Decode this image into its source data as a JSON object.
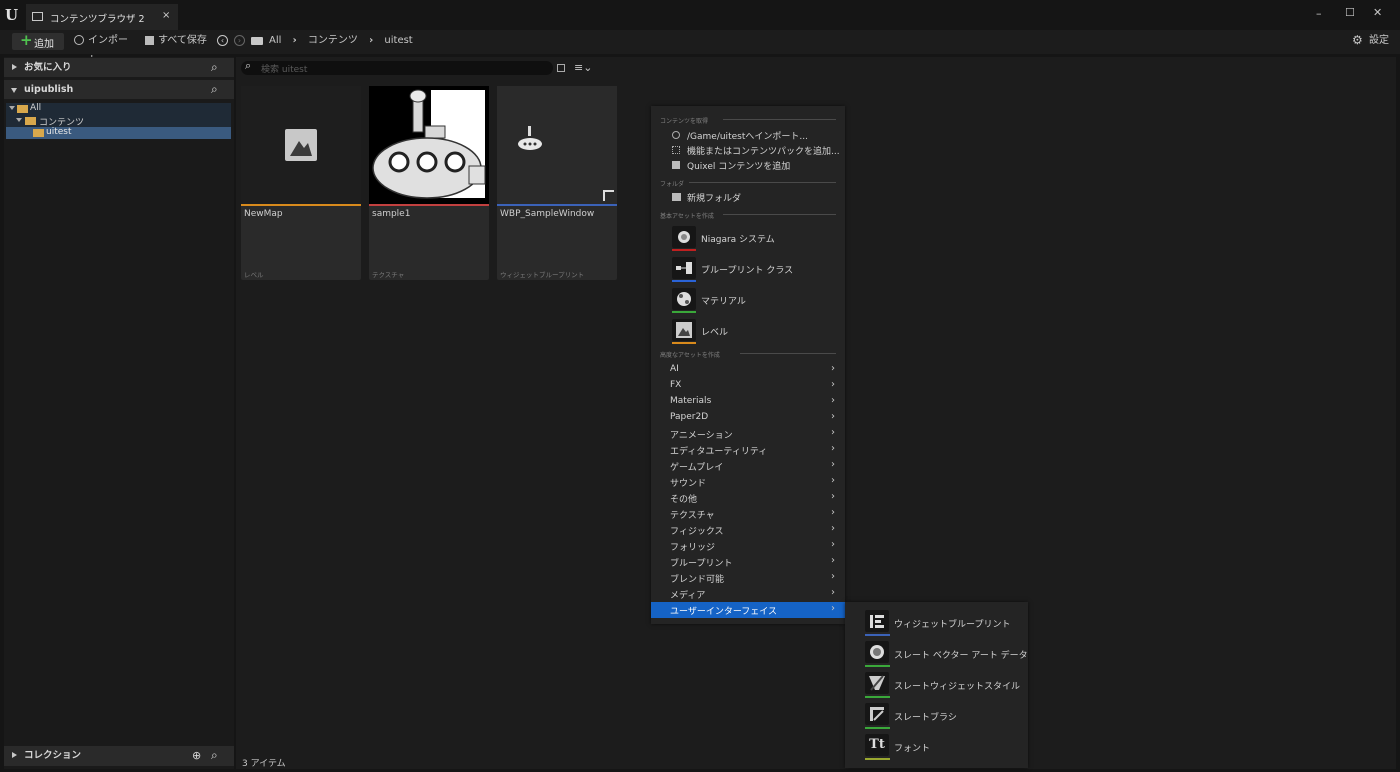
{
  "window": {
    "tab_title": "コンテンツブラウザ 2",
    "tab_close": "×",
    "controls": {
      "minimize": "–",
      "maximize": "☐",
      "close": "✕"
    }
  },
  "toolbar": {
    "add_label": "追加",
    "import_label": "インポート",
    "save_all_label": "すべて保存",
    "breadcrumb": [
      "All",
      "コンテンツ",
      "uitest"
    ],
    "settings_label": "設定"
  },
  "sidebar": {
    "favorites_label": "お気に入り",
    "project_label": "uipublish",
    "tree": [
      {
        "label": "All"
      },
      {
        "label": "コンテンツ"
      },
      {
        "label": "uitest"
      }
    ],
    "collections_label": "コレクション"
  },
  "content": {
    "search_placeholder": "検索 uitest",
    "item_count": "3 アイテム",
    "assets": [
      {
        "name": "NewMap",
        "type": "レベル",
        "color": "#d88a1c"
      },
      {
        "name": "sample1",
        "type": "テクスチャ",
        "color": "#c2403f"
      },
      {
        "name": "WBP_SampleWindow",
        "type": "ウィジェットブループリント",
        "color": "#3b62b8"
      }
    ]
  },
  "context_menu": {
    "section_get_content": "コンテンツを取得",
    "import_to": "/Game/uitestへインポート...",
    "add_feature_pack": "機能またはコンテンツパックを追加...",
    "add_quixel": "Quixel コンテンツを追加",
    "section_folder": "フォルダ",
    "new_folder": "新規フォルダ",
    "section_basic": "基本アセットを作成",
    "basic_assets": [
      {
        "label": "Niagara システム",
        "color": "#c02020"
      },
      {
        "label": "ブループリント クラス",
        "color": "#2a63d6"
      },
      {
        "label": "マテリアル",
        "color": "#3aa83a"
      },
      {
        "label": "レベル",
        "color": "#d88a1c"
      }
    ],
    "section_advanced": "高度なアセットを作成",
    "advanced_items": [
      "AI",
      "FX",
      "Materials",
      "Paper2D",
      "アニメーション",
      "エディタユーティリティ",
      "ゲームプレイ",
      "サウンド",
      "その他",
      "テクスチャ",
      "フィジックス",
      "フォリッジ",
      "ブループリント",
      "ブレンド可能",
      "メディア",
      "ユーザーインターフェイス"
    ],
    "highlight_color": "#1563c6"
  },
  "submenu": {
    "items": [
      {
        "label": "ウィジェットブループリント",
        "color": "#3b62b8"
      },
      {
        "label": "スレート ベクター アート データ",
        "color": "#3aa83a"
      },
      {
        "label": "スレートウィジェットスタイル",
        "color": "#3aa83a"
      },
      {
        "label": "スレートブラシ",
        "color": "#3aa83a"
      },
      {
        "label": "フォント",
        "color": "#9aa830"
      }
    ]
  }
}
